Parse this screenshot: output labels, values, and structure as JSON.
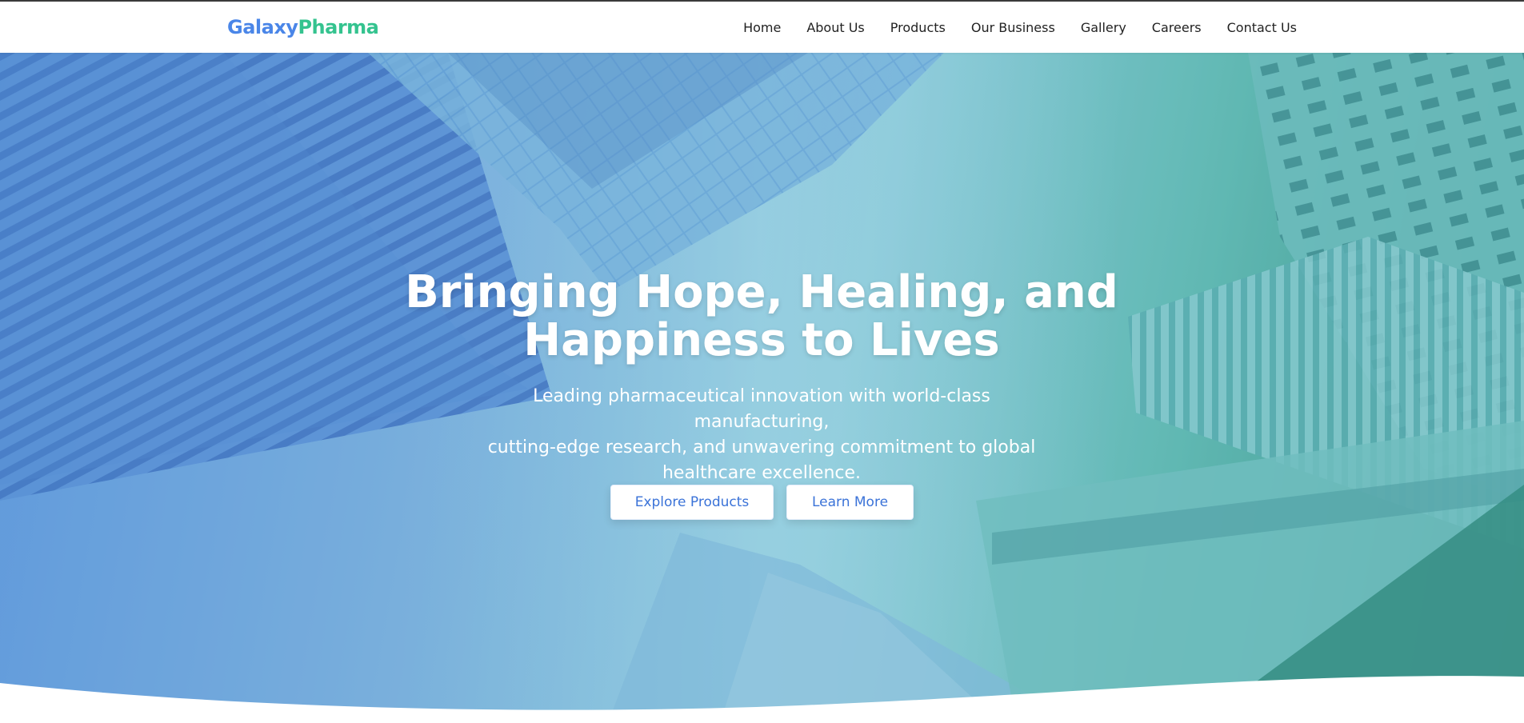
{
  "brand": {
    "part1": "Galaxy",
    "part2": "Pharma"
  },
  "nav": {
    "items": [
      {
        "label": "Home",
        "name": "nav-home"
      },
      {
        "label": "About Us",
        "name": "nav-about-us"
      },
      {
        "label": "Products",
        "name": "nav-products"
      },
      {
        "label": "Our Business",
        "name": "nav-our-business"
      },
      {
        "label": "Gallery",
        "name": "nav-gallery"
      },
      {
        "label": "Careers",
        "name": "nav-careers"
      },
      {
        "label": "Contact Us",
        "name": "nav-contact-us"
      }
    ]
  },
  "hero": {
    "title_line1": "Bringing Hope, Healing, and",
    "title_line2": "Happiness to Lives",
    "subtitle_line1": "Leading pharmaceutical innovation with world-class manufacturing,",
    "subtitle_line2": "cutting-edge research, and unwavering commitment to global",
    "subtitle_line3": "healthcare excellence.",
    "primary_button": "Explore Products",
    "secondary_button": "Learn More"
  },
  "colors": {
    "brand_blue": "#4a86e8",
    "brand_green": "#34c38f",
    "button_text": "#3b73d8"
  }
}
